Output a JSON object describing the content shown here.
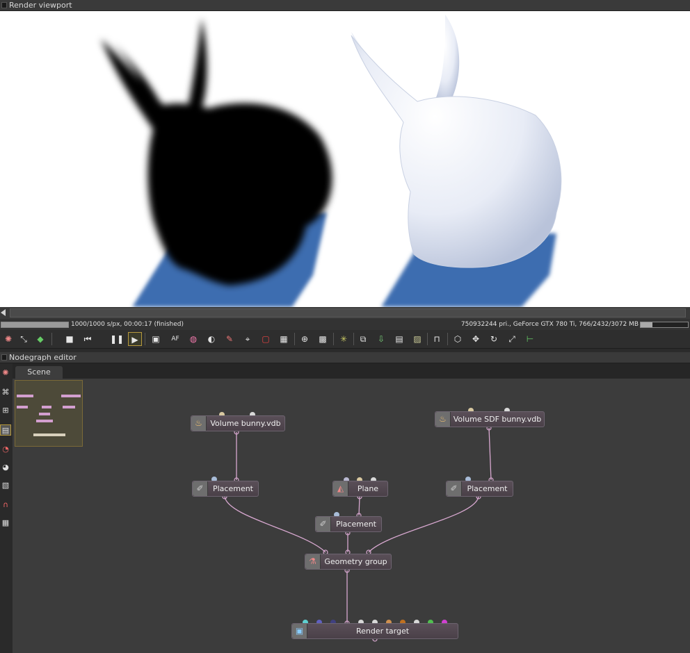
{
  "panels": {
    "render_viewport_title": "Render viewport",
    "nodegraph_title": "Nodegraph editor",
    "scene_tab": "Scene"
  },
  "status": {
    "left": "1000/1000 s/px, 00:00:17 (finished)",
    "right": "750932244 pri., GeForce GTX 780 Ti, 766/2432/3072 MB",
    "progress": 1.0,
    "memory_fraction": 0.25
  },
  "toolbar": {
    "icons": [
      "reset-icon",
      "fit-icon",
      "color-cube-icon",
      "stop-icon",
      "rewind-icon",
      "pause-icon",
      "play-icon",
      "monitor-icon",
      "af-icon",
      "color-wheel-icon",
      "sphere-icon",
      "brush-icon",
      "camera-icon",
      "region-icon",
      "region2-icon",
      "zoom-icon",
      "checker-icon",
      "spinner-icon",
      "copy-icon",
      "export-icon",
      "clipboard-icon",
      "photo-icon",
      "lock-icon",
      "cube-icon",
      "move-icon",
      "rotate-icon",
      "scale-icon",
      "axis-icon"
    ],
    "af_label": "AF",
    "play_active": true
  },
  "nodes": [
    {
      "id": "vol",
      "label": "Volume bunny.vdb",
      "icon": "flame-icon"
    },
    {
      "id": "sdf",
      "label": "Volume SDF bunny.vdb",
      "icon": "flame-icon"
    },
    {
      "id": "pl1",
      "label": "Placement",
      "icon": "placement-icon"
    },
    {
      "id": "plane",
      "label": "Plane",
      "icon": "plane-icon"
    },
    {
      "id": "pl2",
      "label": "Placement",
      "icon": "placement-icon"
    },
    {
      "id": "pl3",
      "label": "Placement",
      "icon": "placement-icon"
    },
    {
      "id": "geo",
      "label": "Geometry group",
      "icon": "geometry-icon"
    },
    {
      "id": "rt",
      "label": "Render target",
      "icon": "render-target-icon"
    }
  ],
  "colors": {
    "wire": "#d8a8d0",
    "shadow_blue": "#3f6fae",
    "node_bg": "#4f454d"
  }
}
